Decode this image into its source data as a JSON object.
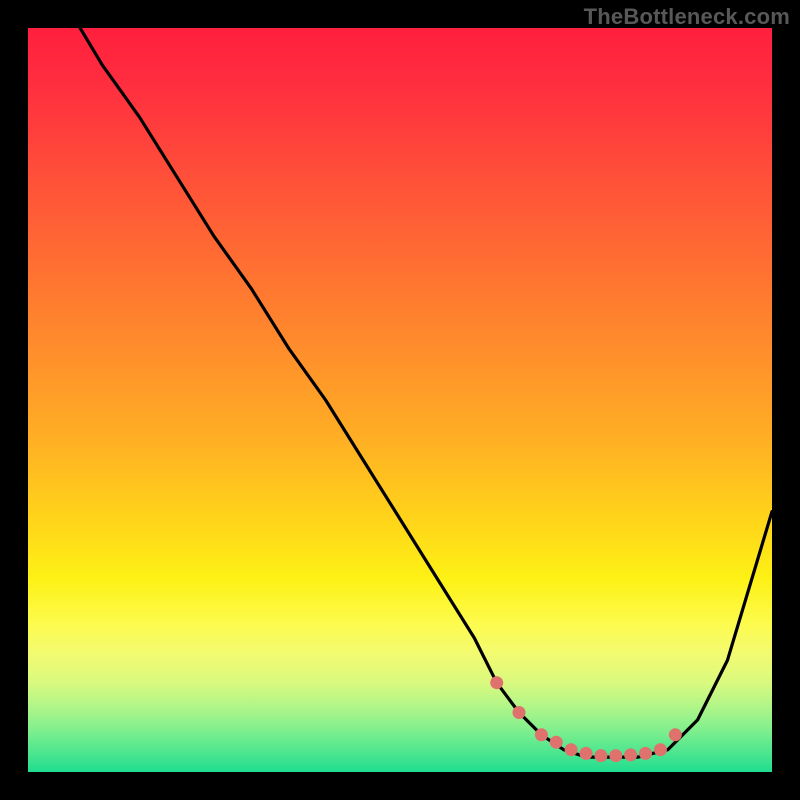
{
  "watermark": "TheBottleneck.com",
  "colors": {
    "background": "#000000",
    "curve": "#000000",
    "marker": "#e0726e",
    "watermark": "#585858"
  },
  "chart_data": {
    "type": "line",
    "title": "",
    "xlabel": "",
    "ylabel": "",
    "xlim": [
      0,
      100
    ],
    "ylim": [
      0,
      100
    ],
    "grid": false,
    "legend": false,
    "annotations": [
      "TheBottleneck.com"
    ],
    "series": [
      {
        "name": "bottleneck-curve",
        "x": [
          7,
          10,
          15,
          20,
          25,
          30,
          35,
          40,
          45,
          50,
          55,
          60,
          63,
          66,
          69,
          72,
          75,
          78,
          82,
          86,
          90,
          94,
          100
        ],
        "values": [
          100,
          95,
          88,
          80,
          72,
          65,
          57,
          50,
          42,
          34,
          26,
          18,
          12,
          8,
          5,
          3,
          2,
          2,
          2,
          3,
          7,
          15,
          35
        ]
      }
    ],
    "markers": {
      "name": "highlight-dots",
      "x": [
        63,
        66,
        69,
        71,
        73,
        75,
        77,
        79,
        81,
        83,
        85,
        87
      ],
      "values": [
        12,
        8,
        5,
        4,
        3,
        2.5,
        2.2,
        2.2,
        2.3,
        2.5,
        3,
        5
      ]
    }
  }
}
